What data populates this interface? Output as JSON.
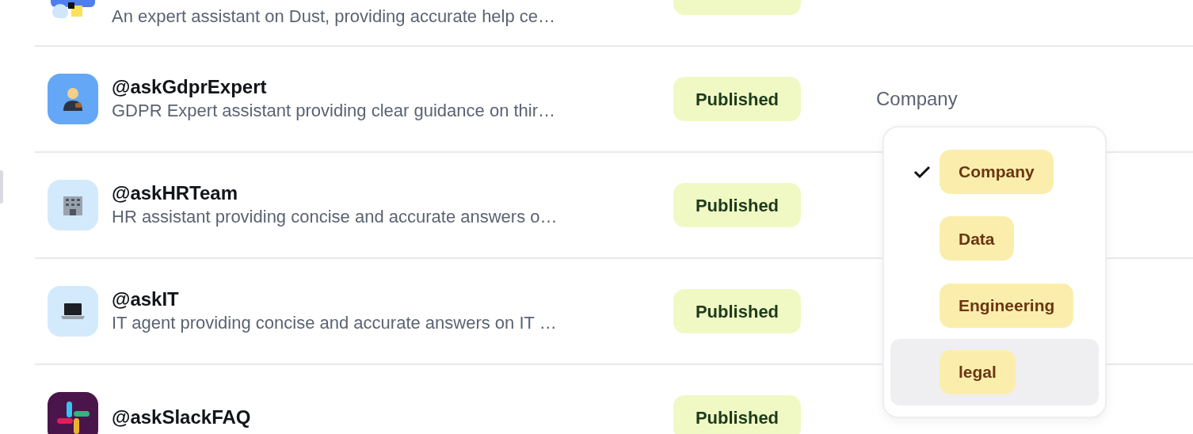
{
  "agents": [
    {
      "description": "An expert assistant on Dust, providing accurate help ce…"
    },
    {
      "name": "@askGdprExpert",
      "description": "GDPR Expert assistant providing clear guidance on thir…",
      "status": "Published",
      "category": "Company"
    },
    {
      "name": "@askHRTeam",
      "description": "HR assistant providing concise and accurate answers o…",
      "status": "Published"
    },
    {
      "name": "@askIT",
      "description": "IT agent providing concise and accurate answers on IT …",
      "status": "Published"
    },
    {
      "name": "@askSlackFAQ",
      "status": "Published"
    }
  ],
  "category_menu": {
    "items": [
      {
        "label": "Company",
        "checked": true,
        "selected": false
      },
      {
        "label": "Data",
        "checked": false,
        "selected": false
      },
      {
        "label": "Engineering",
        "checked": false,
        "selected": false
      },
      {
        "label": "legal",
        "checked": false,
        "selected": true
      }
    ]
  }
}
